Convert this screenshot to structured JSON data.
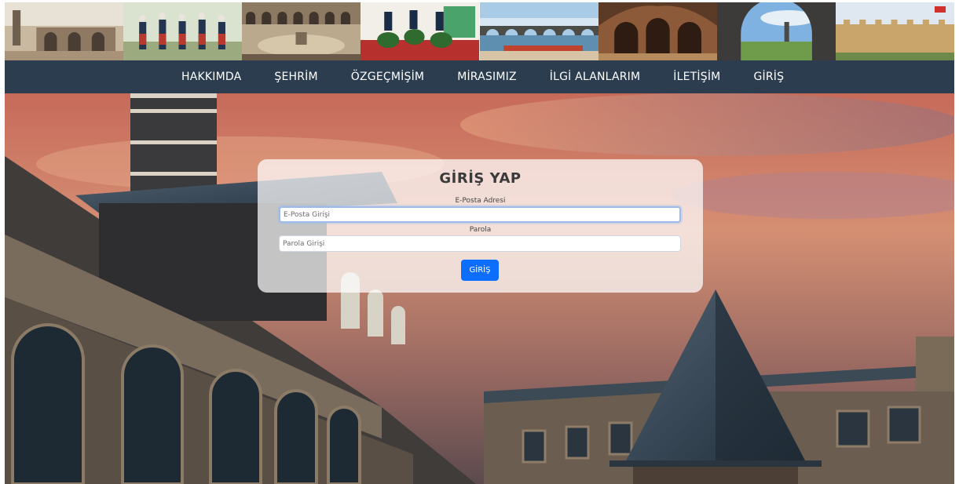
{
  "banner": {
    "photos": [
      "mosque-courtyard-photo",
      "folk-dancers-photo",
      "caravanserai-courtyard-photo",
      "watermelon-festival-photo",
      "ten-eyed-bridge-photo",
      "arched-hall-interior-photo",
      "ancient-city-wall-arch-photo",
      "fortress-walls-photo"
    ]
  },
  "nav": {
    "items": [
      "HAKKIMDA",
      "ŞEHRİM",
      "ÖZGEÇMİŞİM",
      "MİRASIMIZ",
      "İLGİ ALANLARIM",
      "İLETİŞİM",
      "GİRİŞ"
    ]
  },
  "login": {
    "title": "GİRİŞ YAP",
    "email_label": "E-Posta Adresi",
    "email_placeholder": "E-Posta Girişi",
    "password_label": "Parola",
    "password_placeholder": "Parola Girişi",
    "submit_label": "GİRİŞ"
  },
  "colors": {
    "navbar_bg": "#2b3d4f",
    "button_bg": "#0d6efd",
    "card_bg": "rgba(255,255,255,0.72)"
  }
}
